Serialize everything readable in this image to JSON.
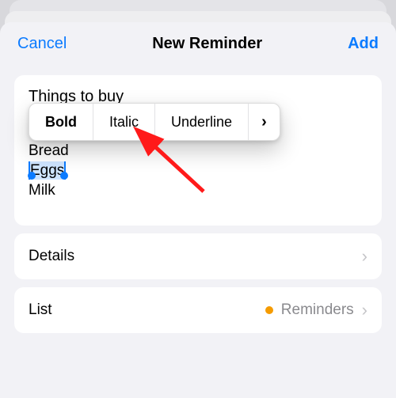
{
  "nav": {
    "cancel": "Cancel",
    "title": "New Reminder",
    "add": "Add"
  },
  "editor": {
    "title_text": "Things to buy",
    "notes_line1": "Bread",
    "notes_selected": "Eggs",
    "notes_line3": "Milk"
  },
  "popover": {
    "bold": "Bold",
    "italic": "Italic",
    "underline": "Underline"
  },
  "rows": {
    "details": "Details",
    "list_label": "List",
    "list_value": "Reminders"
  }
}
